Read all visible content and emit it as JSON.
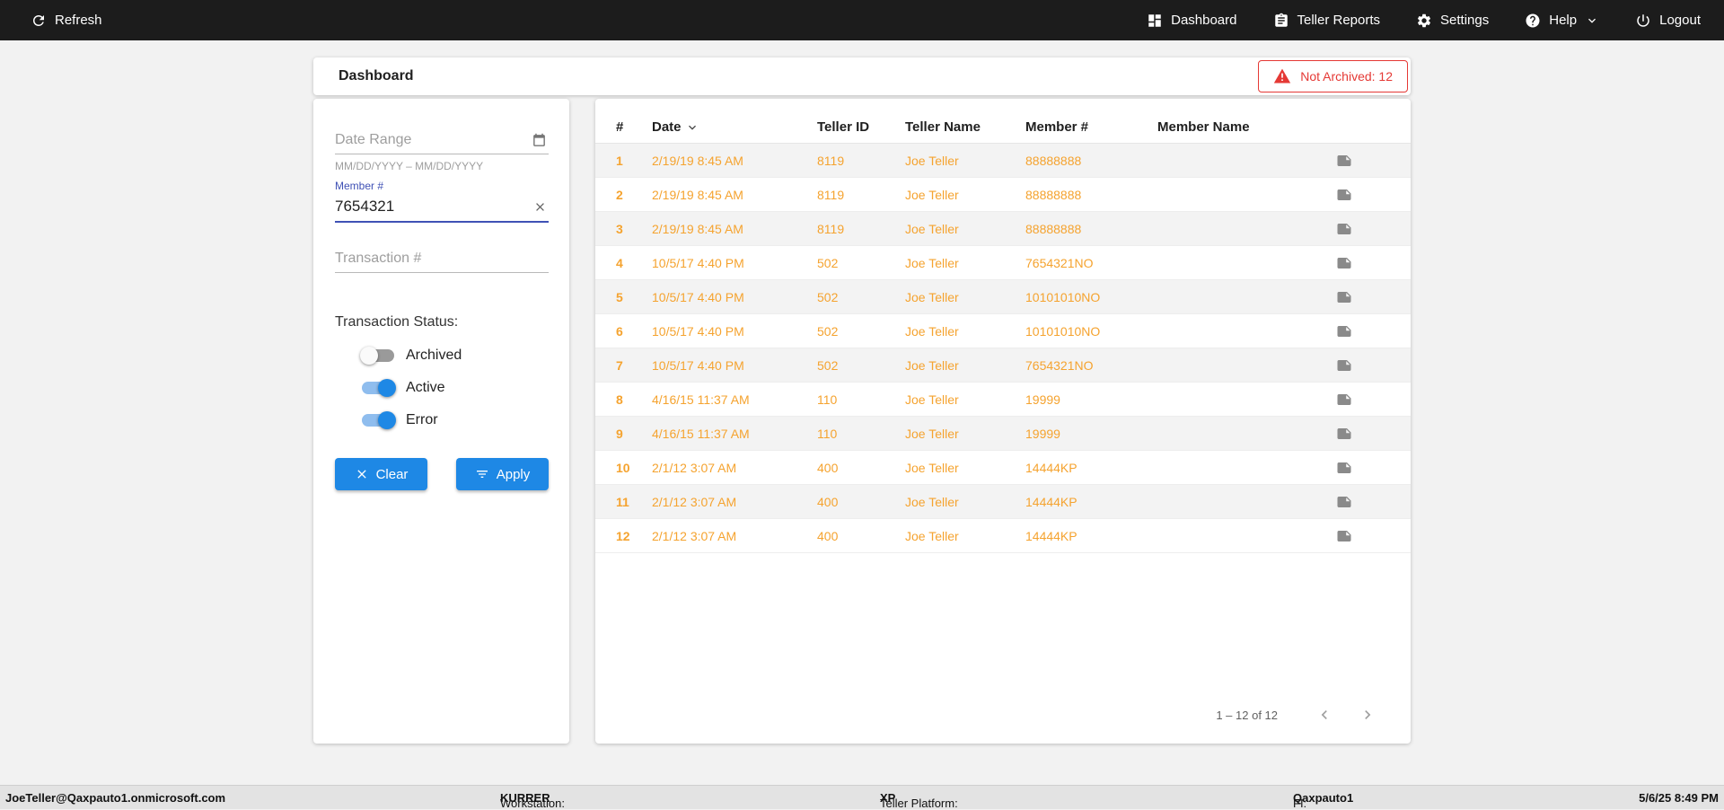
{
  "topbar": {
    "refresh": "Refresh",
    "dashboard": "Dashboard",
    "teller_reports": "Teller Reports",
    "settings": "Settings",
    "help": "Help",
    "logout": "Logout"
  },
  "header": {
    "title": "Dashboard",
    "not_archived_badge": "Not Archived: 12"
  },
  "filters": {
    "date_range_placeholder": "Date Range",
    "date_range_hint": "MM/DD/YYYY – MM/DD/YYYY",
    "member_label": "Member #",
    "member_value": "7654321",
    "transaction_placeholder": "Transaction #",
    "status_label": "Transaction Status:",
    "toggles": [
      {
        "label": "Archived",
        "on": false
      },
      {
        "label": "Active",
        "on": true
      },
      {
        "label": "Error",
        "on": true
      }
    ],
    "clear_label": "Clear",
    "apply_label": "Apply"
  },
  "table": {
    "columns": [
      "#",
      "Date",
      "Teller ID",
      "Teller Name",
      "Member #",
      "Member Name"
    ],
    "rows": [
      {
        "num": "1",
        "date": "2/19/19 8:45 AM",
        "teller_id": "8119",
        "teller_name": "Joe Teller",
        "member": "88888888",
        "member_name": ""
      },
      {
        "num": "2",
        "date": "2/19/19 8:45 AM",
        "teller_id": "8119",
        "teller_name": "Joe Teller",
        "member": "88888888",
        "member_name": ""
      },
      {
        "num": "3",
        "date": "2/19/19 8:45 AM",
        "teller_id": "8119",
        "teller_name": "Joe Teller",
        "member": "88888888",
        "member_name": ""
      },
      {
        "num": "4",
        "date": "10/5/17 4:40 PM",
        "teller_id": "502",
        "teller_name": "Joe Teller",
        "member": "7654321NO",
        "member_name": ""
      },
      {
        "num": "5",
        "date": "10/5/17 4:40 PM",
        "teller_id": "502",
        "teller_name": "Joe Teller",
        "member": "10101010NO",
        "member_name": ""
      },
      {
        "num": "6",
        "date": "10/5/17 4:40 PM",
        "teller_id": "502",
        "teller_name": "Joe Teller",
        "member": "10101010NO",
        "member_name": ""
      },
      {
        "num": "7",
        "date": "10/5/17 4:40 PM",
        "teller_id": "502",
        "teller_name": "Joe Teller",
        "member": "7654321NO",
        "member_name": ""
      },
      {
        "num": "8",
        "date": "4/16/15 11:37 AM",
        "teller_id": "110",
        "teller_name": "Joe Teller",
        "member": "19999",
        "member_name": ""
      },
      {
        "num": "9",
        "date": "4/16/15 11:37 AM",
        "teller_id": "110",
        "teller_name": "Joe Teller",
        "member": "19999",
        "member_name": ""
      },
      {
        "num": "10",
        "date": "2/1/12 3:07 AM",
        "teller_id": "400",
        "teller_name": "Joe Teller",
        "member": "14444KP",
        "member_name": ""
      },
      {
        "num": "11",
        "date": "2/1/12 3:07 AM",
        "teller_id": "400",
        "teller_name": "Joe Teller",
        "member": "14444KP",
        "member_name": ""
      },
      {
        "num": "12",
        "date": "2/1/12 3:07 AM",
        "teller_id": "400",
        "teller_name": "Joe Teller",
        "member": "14444KP",
        "member_name": ""
      }
    ],
    "pagination": "1 – 12 of 12"
  },
  "footer": {
    "user": "JoeTeller@Qaxpauto1.onmicrosoft.com",
    "workstation_label": "Workstation:",
    "workstation_value": "KURRER",
    "platform_label": "Teller Platform:",
    "platform_value": "XP",
    "fi_label": "FI:",
    "fi_value": "Qaxpauto1",
    "datetime": "5/6/25 8:49 PM"
  },
  "icons": {
    "refresh": "refresh-icon",
    "dashboard": "dashboard-grid-icon",
    "teller_reports": "clipboard-icon",
    "settings": "gear-icon",
    "help": "question-circle-icon",
    "logout": "power-icon",
    "warning": "warning-triangle-icon",
    "calendar": "calendar-icon",
    "clear_field": "close-icon",
    "filter": "filter-icon",
    "sort": "chevron-down-icon",
    "note": "note-icon"
  },
  "colors": {
    "accent": "#1e88e5",
    "indigo": "#3f51b5",
    "orange": "#f5a32f",
    "red": "#e53935",
    "topbar": "#1c1c1c"
  }
}
